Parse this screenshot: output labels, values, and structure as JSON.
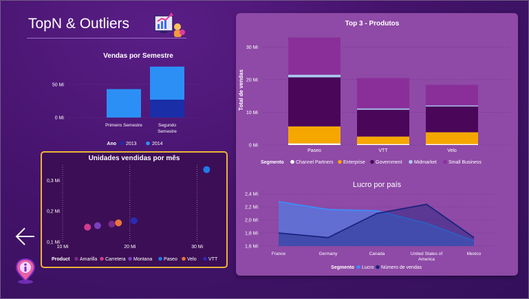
{
  "page": {
    "title": "TopN & Outliers"
  },
  "icons": {
    "hero": "analytics-illustration-icon",
    "back": "back-arrow-icon",
    "info": "info-location-icon"
  },
  "colors": {
    "bg_dark": "#33105a",
    "card": "#8e4aa6",
    "scatter_border": "#f0b43a",
    "series_2013": "#1a2ea8",
    "series_2014": "#2b8ff5",
    "channel_partners": "#ffffff",
    "enterprise": "#f5a700",
    "government": "#4a0659",
    "midmarket": "#a9cbef",
    "small_business": "#8a2f9a",
    "lucro": "#3f8cf7",
    "numero_vendas": "#1a237e"
  },
  "chart_data": [
    {
      "id": "vendas-semestre",
      "type": "bar",
      "title": "Vendas por Semestre",
      "categories": [
        "Primeiro Semestre",
        "Segundo Semestre"
      ],
      "series": [
        {
          "name": "2013",
          "values": [
            0,
            27
          ]
        },
        {
          "name": "2014",
          "values": [
            43,
            50
          ]
        }
      ],
      "stacked": true,
      "yticks": [
        "0 Mi",
        "50 Mi"
      ],
      "ylim": [
        0,
        80
      ],
      "legend_title": "Ano",
      "legend_position": "bottom"
    },
    {
      "id": "unidades-mes",
      "type": "scatter",
      "title": "Unidades vendidas por mês",
      "xticks": [
        "10 Mi",
        "20 Mi",
        "30 Mi"
      ],
      "yticks": [
        "0,1 Mi",
        "0,2 Mi",
        "0,3 Mi"
      ],
      "xlim": [
        10,
        33
      ],
      "ylim": [
        0.1,
        0.35
      ],
      "legend_title": "Product",
      "series": [
        {
          "name": "Amarilla",
          "color": "#7a2a8a",
          "x": [
            17.3
          ],
          "y": [
            0.158
          ]
        },
        {
          "name": "Carretera",
          "color": "#d23a8e",
          "x": [
            13.7
          ],
          "y": [
            0.148
          ]
        },
        {
          "name": "Montana",
          "color": "#7a3fc0",
          "x": [
            15.2
          ],
          "y": [
            0.153
          ]
        },
        {
          "name": "Paseo",
          "color": "#1f7be8",
          "x": [
            31.4
          ],
          "y": [
            0.335
          ]
        },
        {
          "name": "Velo",
          "color": "#e8743a",
          "x": [
            18.3
          ],
          "y": [
            0.162
          ]
        },
        {
          "name": "VTT",
          "color": "#2b2bb5",
          "x": [
            20.6
          ],
          "y": [
            0.169
          ]
        }
      ],
      "legend_position": "bottom"
    },
    {
      "id": "top3-produtos",
      "type": "bar",
      "title": "Top 3 - Produtos",
      "ylabel": "Total de vendas",
      "categories": [
        "Paseo",
        "VTT",
        "Velo"
      ],
      "yticks": [
        "0 Mi",
        "10 Mi",
        "20 Mi",
        "30 Mi"
      ],
      "ylim": [
        0,
        33
      ],
      "stacked": true,
      "legend_title": "Segmento",
      "series": [
        {
          "name": "Channel Partners",
          "values": [
            0.5,
            0.3,
            0.3
          ]
        },
        {
          "name": "Enterprise",
          "values": [
            5.2,
            2.3,
            3.6
          ]
        },
        {
          "name": "Government",
          "values": [
            15,
            8.2,
            7.9
          ]
        },
        {
          "name": "Midmarket",
          "values": [
            0.8,
            0.4,
            0.3
          ]
        },
        {
          "name": "Small Business",
          "values": [
            11.4,
            9.3,
            6.3
          ]
        }
      ],
      "legend_position": "bottom"
    },
    {
      "id": "lucro-pais",
      "type": "area",
      "title": "Lucro por país",
      "categories": [
        "France",
        "Germany",
        "Canada",
        "United States of America",
        "Mexico"
      ],
      "yticks": [
        "1,6 Mi",
        "1,8 Mi",
        "2,0 Mi",
        "2,2 Mi",
        "2,4 Mi"
      ],
      "ylim": [
        1.6,
        2.4
      ],
      "legend_title": "Segmento",
      "series": [
        {
          "name": "Lucro",
          "values": [
            2.28,
            2.16,
            2.14,
            1.95,
            1.68
          ]
        },
        {
          "name": "Número de vendas",
          "values": [
            1.8,
            1.73,
            2.1,
            2.24,
            1.73
          ]
        }
      ],
      "legend_position": "bottom"
    }
  ]
}
